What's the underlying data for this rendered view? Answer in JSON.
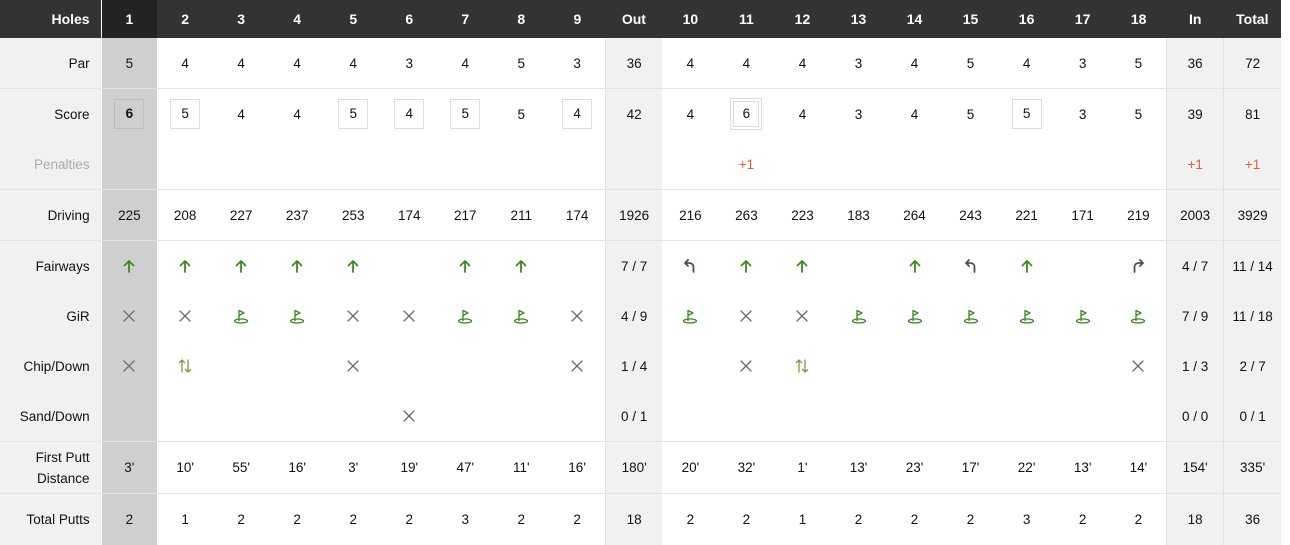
{
  "colors": {
    "header_bg": "#333333",
    "highlight_col": "#cfcfcf",
    "label_bg": "#f1f1f1",
    "penalty": "#e8602c",
    "hit": "#3a8a1e",
    "miss": "#666666"
  },
  "header": {
    "label": "Holes",
    "holes": [
      "1",
      "2",
      "3",
      "4",
      "5",
      "6",
      "7",
      "8",
      "9",
      "10",
      "11",
      "12",
      "13",
      "14",
      "15",
      "16",
      "17",
      "18"
    ],
    "out": "Out",
    "in": "In",
    "total": "Total"
  },
  "rows": {
    "par": {
      "label": "Par",
      "front": [
        "5",
        "4",
        "4",
        "4",
        "4",
        "3",
        "4",
        "5",
        "3"
      ],
      "out": "36",
      "back": [
        "4",
        "4",
        "4",
        "3",
        "4",
        "5",
        "4",
        "3",
        "5"
      ],
      "in": "36",
      "total": "72"
    },
    "score": {
      "label": "Score",
      "front": [
        "6",
        "5",
        "4",
        "4",
        "5",
        "4",
        "5",
        "5",
        "4"
      ],
      "out": "42",
      "back": [
        "4",
        "6",
        "4",
        "3",
        "4",
        "5",
        "5",
        "3",
        "5"
      ],
      "in": "39",
      "total": "81",
      "front_mark": [
        "bogey",
        "bogey",
        "none",
        "none",
        "bogey",
        "bogey",
        "bogey",
        "none",
        "bogey"
      ],
      "back_mark": [
        "none",
        "double",
        "none",
        "none",
        "none",
        "none",
        "bogey",
        "none",
        "none"
      ]
    },
    "penalties": {
      "label": "Penalties",
      "front": [
        "",
        "",
        "",
        "",
        "",
        "",
        "",
        "",
        ""
      ],
      "out": "",
      "back": [
        "",
        "+1",
        "",
        "",
        "",
        "",
        "",
        "",
        ""
      ],
      "in": "+1",
      "total": "+1"
    },
    "driving": {
      "label": "Driving",
      "front": [
        "225",
        "208",
        "227",
        "237",
        "253",
        "174",
        "217",
        "211",
        "174"
      ],
      "out": "1926",
      "back": [
        "216",
        "263",
        "223",
        "183",
        "264",
        "243",
        "221",
        "171",
        "219"
      ],
      "in": "2003",
      "total": "3929"
    },
    "fairways": {
      "label": "Fairways",
      "front": [
        "hit-icon",
        "hit-icon",
        "hit-icon",
        "hit-icon",
        "hit-icon",
        "",
        "hit-icon",
        "hit-icon",
        ""
      ],
      "out": "7 / 7",
      "back": [
        "miss-left-icon",
        "hit-icon",
        "hit-icon",
        "",
        "hit-icon",
        "miss-left-icon",
        "hit-icon",
        "",
        "miss-right-icon"
      ],
      "in": "4 / 7",
      "total": "11 / 14"
    },
    "gir": {
      "label": "GiR",
      "front": [
        "miss-icon",
        "miss-icon",
        "flag-icon",
        "flag-icon",
        "miss-icon",
        "miss-icon",
        "flag-icon",
        "flag-icon",
        "miss-icon"
      ],
      "out": "4 / 9",
      "back": [
        "flag-icon",
        "miss-icon",
        "miss-icon",
        "flag-icon",
        "flag-icon",
        "flag-icon",
        "flag-icon",
        "flag-icon",
        "flag-icon"
      ],
      "in": "7 / 9",
      "total": "11 / 18"
    },
    "chip": {
      "label": "Chip/Down",
      "front": [
        "miss-icon",
        "updown-icon",
        "",
        "",
        "miss-icon",
        "",
        "",
        "",
        "miss-icon"
      ],
      "out": "1 / 4",
      "back": [
        "",
        "miss-icon",
        "updown-icon",
        "",
        "",
        "",
        "",
        "",
        "miss-icon"
      ],
      "in": "1 / 3",
      "total": "2 / 7"
    },
    "sand": {
      "label": "Sand/Down",
      "front": [
        "",
        "",
        "",
        "",
        "",
        "miss-icon",
        "",
        "",
        ""
      ],
      "out": "0 / 1",
      "back": [
        "",
        "",
        "",
        "",
        "",
        "",
        "",
        "",
        ""
      ],
      "in": "0 / 0",
      "total": "0 / 1"
    },
    "putt_dist": {
      "label_line1": "First Putt",
      "label_line2": "Distance",
      "front": [
        "3'",
        "10'",
        "55'",
        "16'",
        "3'",
        "19'",
        "47'",
        "11'",
        "16'"
      ],
      "out": "180'",
      "back": [
        "20'",
        "32'",
        "1'",
        "13'",
        "23'",
        "17'",
        "22'",
        "13'",
        "14'"
      ],
      "in": "154'",
      "total": "335'"
    },
    "putts": {
      "label": "Total Putts",
      "front": [
        "2",
        "1",
        "2",
        "2",
        "2",
        "2",
        "3",
        "2",
        "2"
      ],
      "out": "18",
      "back": [
        "2",
        "2",
        "1",
        "2",
        "2",
        "2",
        "3",
        "2",
        "2"
      ],
      "in": "18",
      "total": "36"
    }
  }
}
